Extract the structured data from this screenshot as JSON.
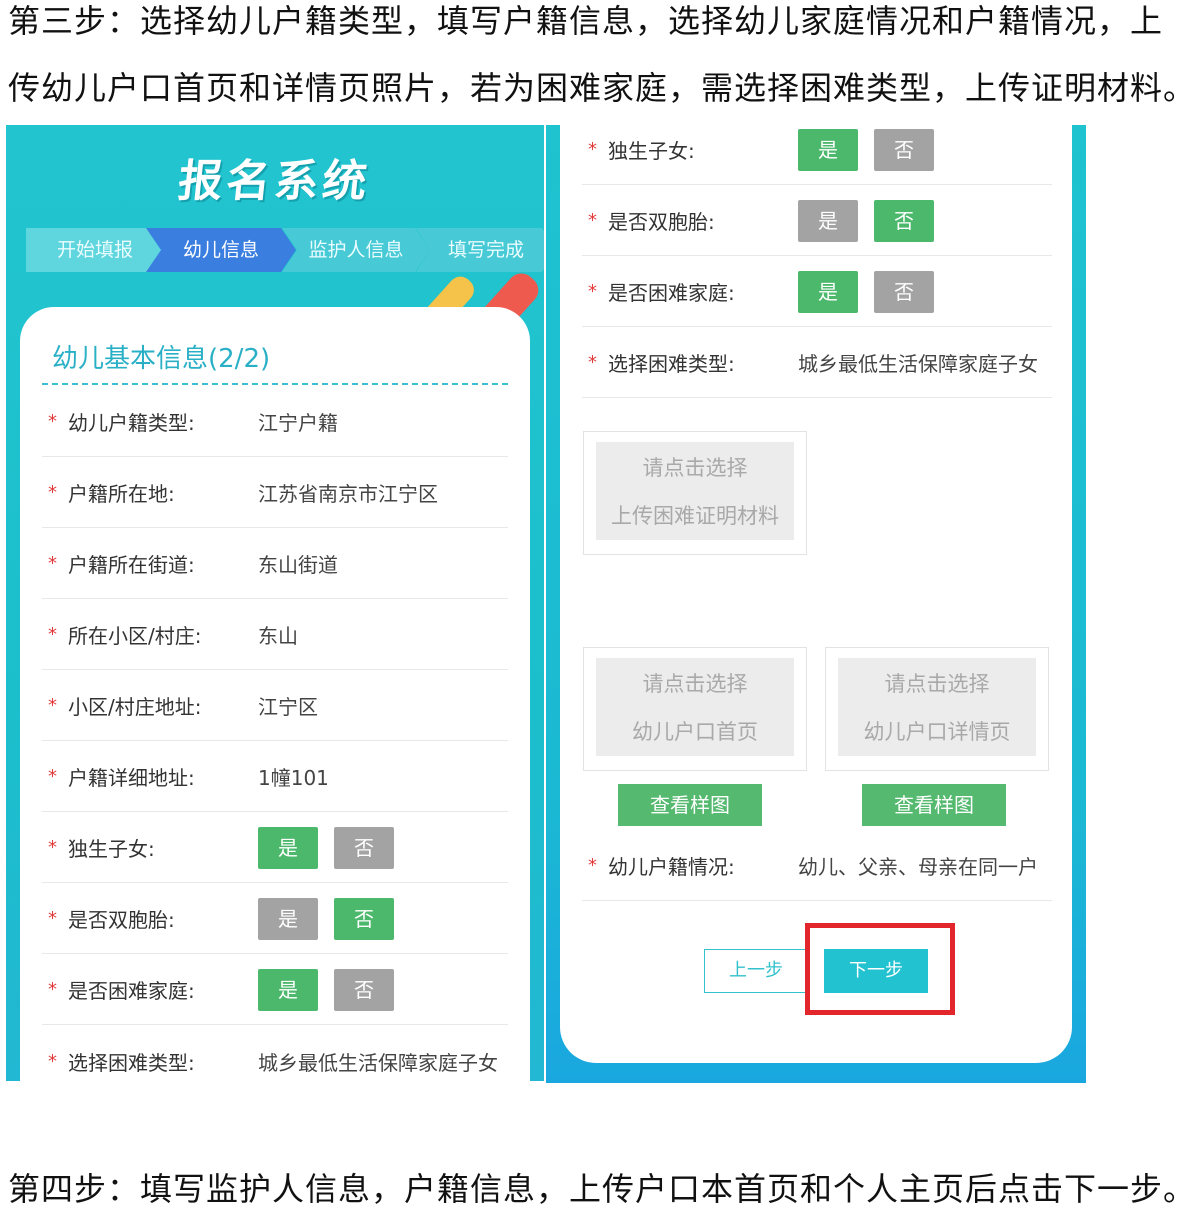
{
  "intro": {
    "line1": "第三步：选择幼儿户籍类型，填写户籍信息，选择幼儿家庭情况和户籍情况，上",
    "line2": "传幼儿户口首页和详情页照片，若为困难家庭，需选择困难类型，上传证明材料。"
  },
  "outro": "第四步：填写监护人信息，户籍信息，上传户口本首页和个人主页后点击下一步。",
  "left": {
    "app_title": "报名系统",
    "steps": [
      "开始填报",
      "幼儿信息",
      "监护人信息",
      "填写完成"
    ],
    "section_title": "幼儿基本信息(2/2)",
    "required_mark": "*",
    "fields": [
      {
        "label": "幼儿户籍类型:",
        "value": "江宁户籍"
      },
      {
        "label": "户籍所在地:",
        "value": "江苏省南京市江宁区"
      },
      {
        "label": "户籍所在街道:",
        "value": "东山街道"
      },
      {
        "label": "所在小区/村庄:",
        "value": "东山"
      },
      {
        "label": "小区/村庄地址:",
        "value": "江宁区"
      },
      {
        "label": "户籍详细地址:",
        "value": "1幢101"
      }
    ],
    "toggles": [
      {
        "label": "独生子女:",
        "yes": "是",
        "no": "否",
        "selected": "yes"
      },
      {
        "label": "是否双胞胎:",
        "yes": "是",
        "no": "否",
        "selected": "no"
      },
      {
        "label": "是否困难家庭:",
        "yes": "是",
        "no": "否",
        "selected": "yes"
      }
    ],
    "hardship_type": {
      "label": "选择困难类型:",
      "value": "城乡最低生活保障家庭子女"
    }
  },
  "right": {
    "required_mark": "*",
    "toggles": [
      {
        "label": "独生子女:",
        "yes": "是",
        "no": "否",
        "selected": "yes"
      },
      {
        "label": "是否双胞胎:",
        "yes": "是",
        "no": "否",
        "selected": "no"
      },
      {
        "label": "是否困难家庭:",
        "yes": "是",
        "no": "否",
        "selected": "yes"
      }
    ],
    "hardship_type": {
      "label": "选择困难类型:",
      "value": "城乡最低生活保障家庭子女"
    },
    "upload_proof": {
      "line1": "请点击选择",
      "line2": "上传困难证明材料"
    },
    "upload_front": {
      "line1": "请点击选择",
      "line2": "幼儿户口首页"
    },
    "upload_detail": {
      "line1": "请点击选择",
      "line2": "幼儿户口详情页"
    },
    "sample_button": "查看样图",
    "household": {
      "label": "幼儿户籍情况:",
      "value": "幼儿、父亲、母亲在同一户"
    },
    "prev_button": "上一步",
    "next_button": "下一步"
  },
  "colors": {
    "teal": "#1ec3cf",
    "green": "#4cb86c",
    "gray": "#a3a3a3",
    "red_highlight": "#e3262b"
  }
}
